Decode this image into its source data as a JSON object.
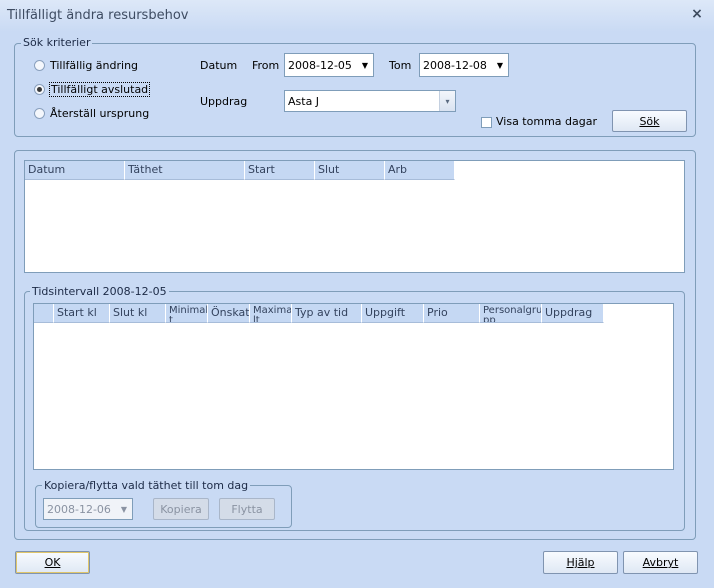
{
  "window": {
    "title": "Tillfälligt ändra resursbehov"
  },
  "criteria": {
    "group_label": "Sök kriterier",
    "radios": [
      {
        "label": "Tillfällig ändring",
        "checked": false
      },
      {
        "label": "Tillfälligt avslutad",
        "checked": true
      },
      {
        "label": "Återställ ursprung",
        "checked": false
      }
    ],
    "datum_label": "Datum",
    "from_label": "From",
    "from_value": "2008-12-05",
    "tom_label": "Tom",
    "tom_value": "2008-12-08",
    "uppdrag_label": "Uppdrag",
    "uppdrag_value": "Asta J",
    "show_empty_label": "Visa tomma dagar",
    "search_button": "Sök"
  },
  "table1": {
    "columns": [
      "Datum",
      "Täthet",
      "Start",
      "Slut",
      "Arb"
    ]
  },
  "interval": {
    "group_label": "Tidsintervall 2008-12-05",
    "columns": [
      "",
      "Start kl",
      "Slut kl",
      "Minimal t",
      "Önskat",
      "Maxima lt",
      "Typ av tid",
      "Uppgift",
      "Prio",
      "Personalgru pp",
      "Uppdrag"
    ],
    "copy_group_label": "Kopiera/flytta vald täthet till tom dag",
    "copy_date_value": "2008-12-06",
    "copy_button": "Kopiera",
    "move_button": "Flytta"
  },
  "footer": {
    "ok_button": "OK",
    "help_button": "Hjälp",
    "cancel_button": "Avbryt"
  }
}
